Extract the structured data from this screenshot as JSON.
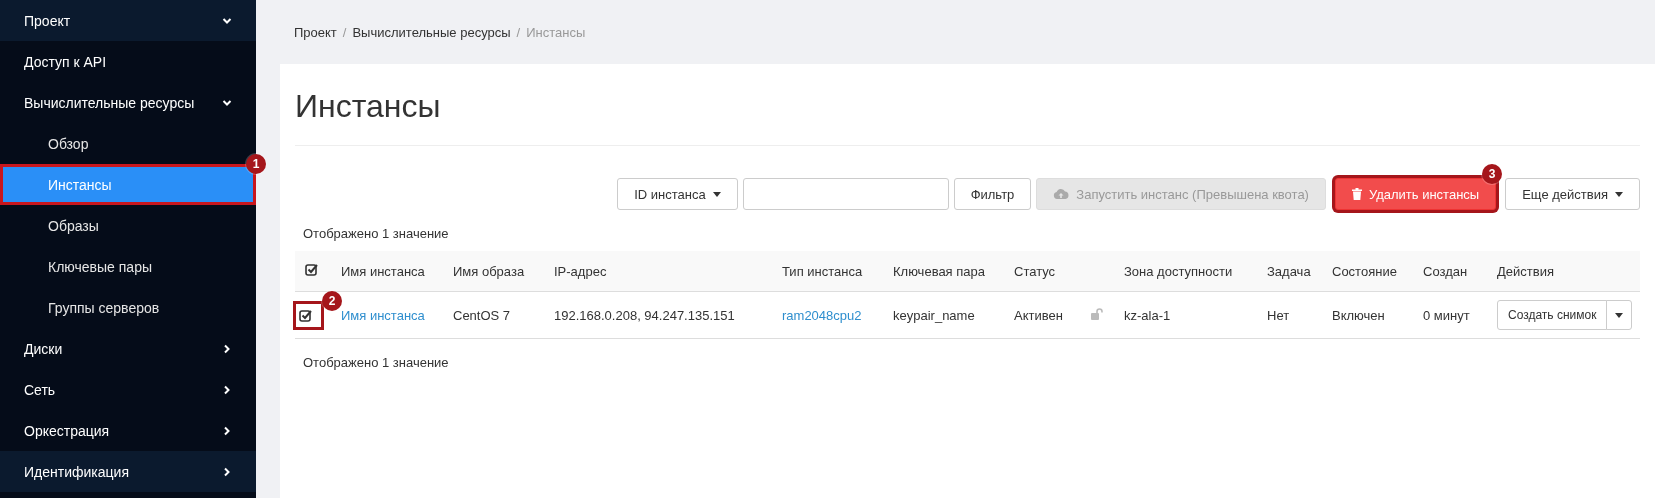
{
  "sidebar": {
    "items": [
      {
        "label": "Проект",
        "expanded": true,
        "children": [
          {
            "label": "Доступ к API"
          },
          {
            "label": "Вычислительные ресурсы",
            "expanded": true,
            "children": [
              {
                "label": "Обзор",
                "selected": false
              },
              {
                "label": "Инстансы",
                "selected": true,
                "callout": "1"
              },
              {
                "label": "Образы",
                "selected": false
              },
              {
                "label": "Ключевые пары",
                "selected": false
              },
              {
                "label": "Группы серверов",
                "selected": false
              }
            ]
          },
          {
            "label": "Диски",
            "expanded": false
          },
          {
            "label": "Сеть",
            "expanded": false
          },
          {
            "label": "Оркестрация",
            "expanded": false
          }
        ]
      },
      {
        "label": "Идентификация",
        "expanded": false
      }
    ]
  },
  "breadcrumb": [
    {
      "label": "Проект",
      "current": false
    },
    {
      "separator": "/",
      "label": "Вычислительные ресурсы",
      "current": false
    },
    {
      "separator": "/",
      "label": "Инстансы",
      "current": true
    }
  ],
  "page_title": "Инстансы",
  "toolbar": {
    "filter_field": {
      "label": "ID инстанса"
    },
    "buttons": [
      {
        "kind": "default",
        "label": "Фильтр",
        "disabled": false
      },
      {
        "kind": "launch",
        "label": "Запустить инстанс (Превышена квота)",
        "disabled": true
      },
      {
        "kind": "danger",
        "label": "Удалить инстансы",
        "disabled": false,
        "callout": "3"
      },
      {
        "kind": "dropdown",
        "label": "Еще действия",
        "disabled": false
      }
    ]
  },
  "summary_top": "Отображено 1 значение",
  "table": {
    "all_checked": true,
    "columns": [
      "",
      "Имя инстанса",
      "Имя образа",
      "IP-адрес",
      "Тип инстанса",
      "Ключевая пара",
      "Статус",
      "",
      "Зона доступности",
      "Задача",
      "Состояние",
      "Создан",
      "Действия"
    ],
    "rows": [
      {
        "checked": true,
        "callout": "2",
        "name": "Имя инстанса",
        "image": "CentOS 7",
        "ip": "192.168.0.208, 94.247.135.151",
        "flavor": "ram2048cpu2",
        "keypair": "keypair_name",
        "status": "Активен",
        "locked": false,
        "zone": "kz-ala-1",
        "task": "Нет",
        "power": "Включен",
        "age": "0 минут",
        "action": "Создать снимок"
      }
    ]
  },
  "summary_bottom": "Отображено 1 значение"
}
